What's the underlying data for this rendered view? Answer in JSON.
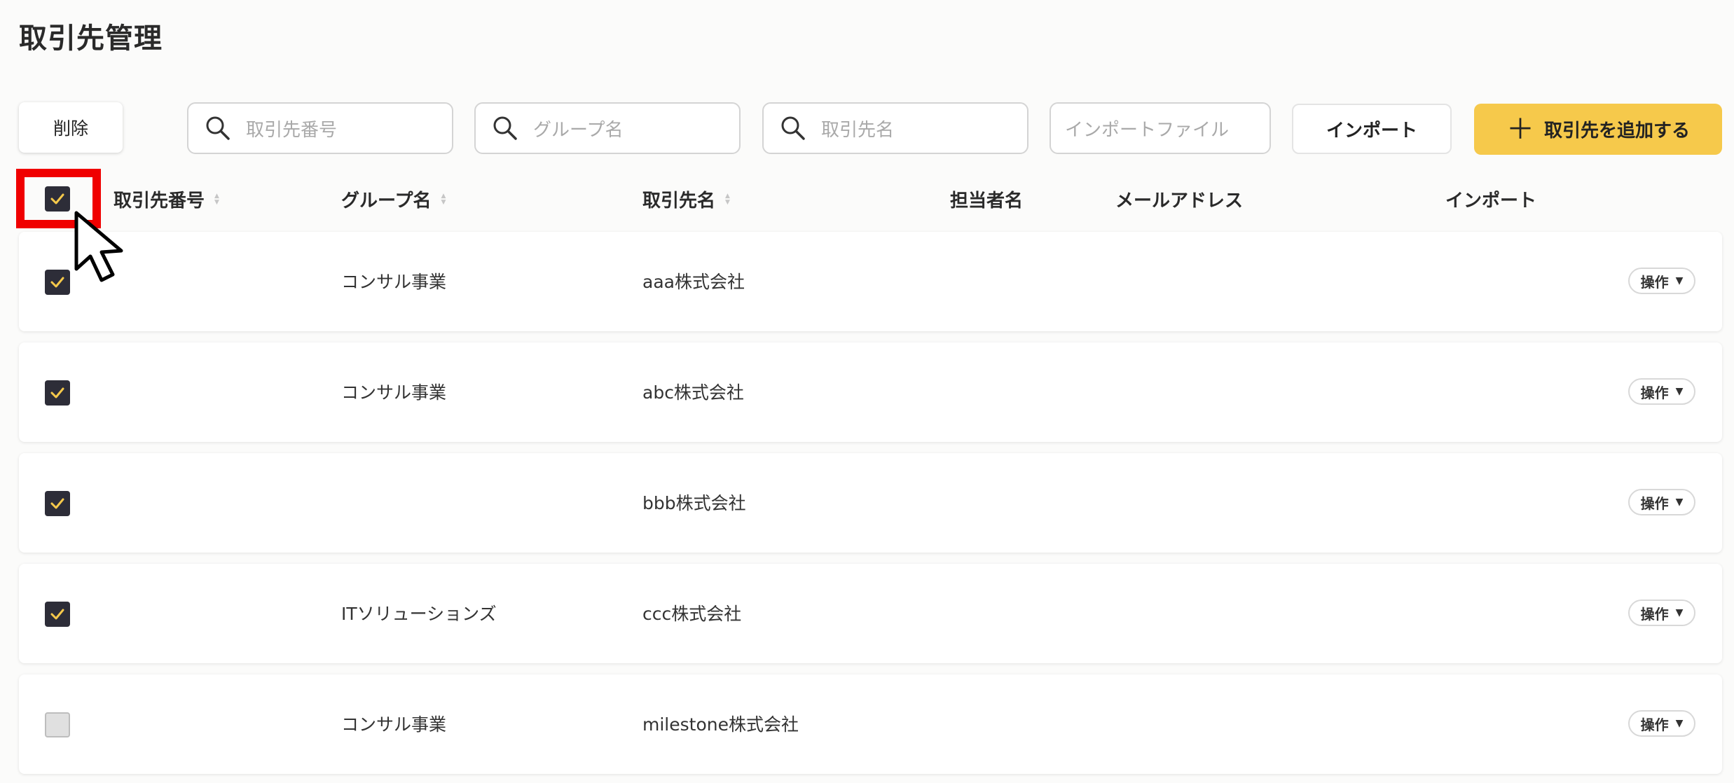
{
  "page": {
    "title": "取引先管理"
  },
  "toolbar": {
    "delete_label": "削除",
    "search_number_placeholder": "取引先番号",
    "search_group_placeholder": "グループ名",
    "search_name_placeholder": "取引先名",
    "import_file_placeholder": "インポートファイル",
    "import_label": "インポート",
    "add_label": "取引先を追加する"
  },
  "table": {
    "select_all_checked": true,
    "headers": {
      "number": "取引先番号",
      "group": "グループ名",
      "name": "取引先名",
      "contact": "担当者名",
      "email": "メールアドレス",
      "import": "インポート"
    },
    "rows": [
      {
        "checked": true,
        "group": "コンサル事業",
        "name": "aaa株式会社",
        "action": "操作"
      },
      {
        "checked": true,
        "group": "コンサル事業",
        "name": "abc株式会社",
        "action": "操作"
      },
      {
        "checked": true,
        "group": "",
        "name": "bbb株式会社",
        "action": "操作"
      },
      {
        "checked": true,
        "group": "ITソリューションズ",
        "name": "ccc株式会社",
        "action": "操作"
      },
      {
        "checked": false,
        "group": "コンサル事業",
        "name": "milestone株式会社",
        "action": "操作"
      }
    ]
  },
  "colors": {
    "accent": "#f6c94b",
    "checkbox_checked": "#2d2d38",
    "check_mark": "#f6c94b",
    "highlight": "#f00000"
  }
}
